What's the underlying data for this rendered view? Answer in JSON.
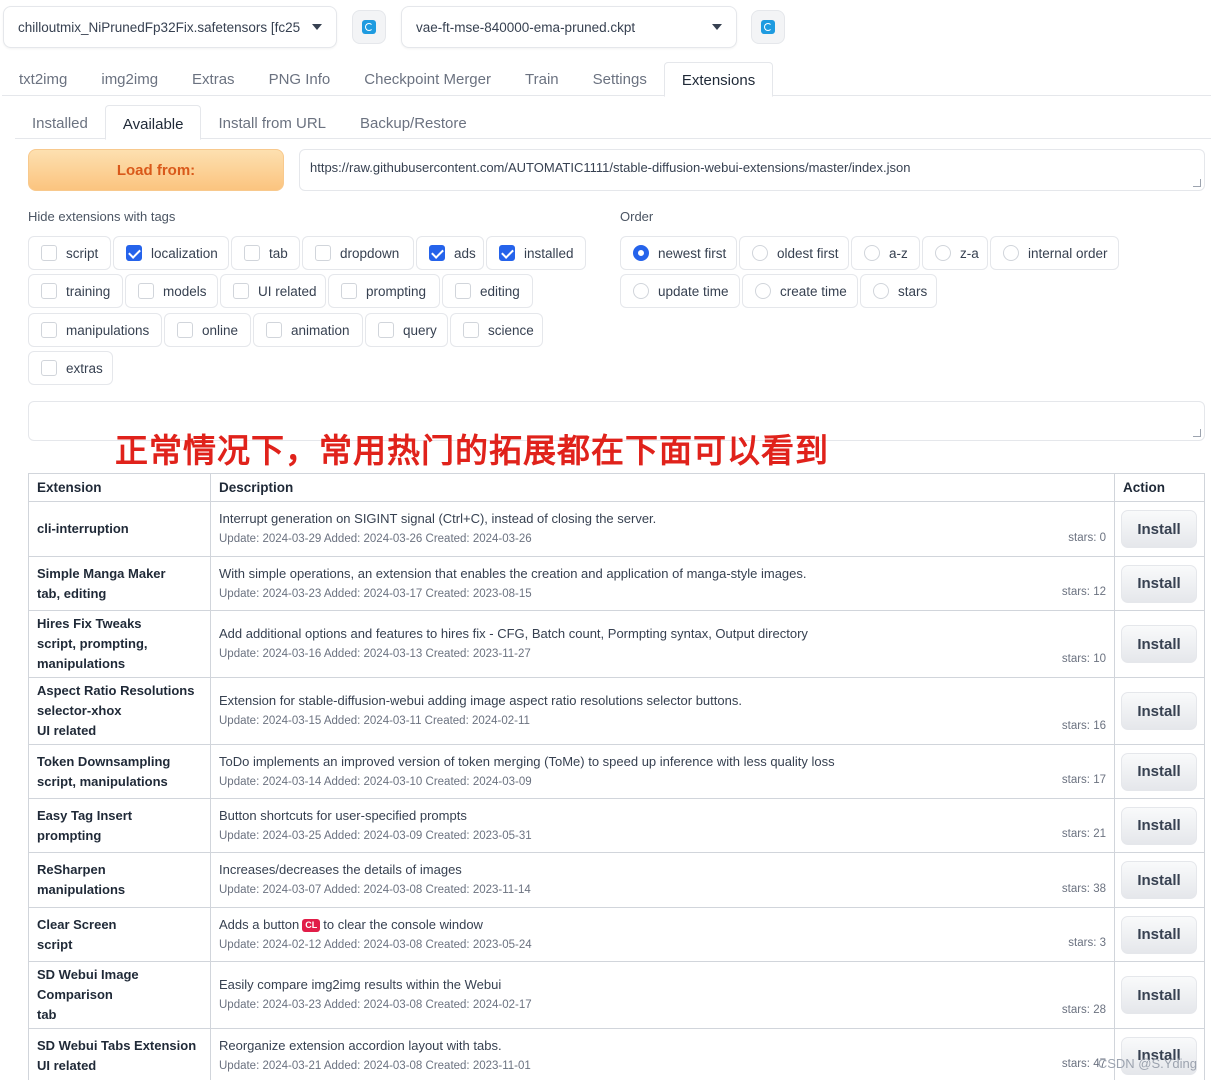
{
  "top": {
    "checkpoint": "chilloutmix_NiPrunedFp32Fix.safetensors [fc25",
    "vae": "vae-ft-mse-840000-ema-pruned.ckpt"
  },
  "tabs": [
    "txt2img",
    "img2img",
    "Extras",
    "PNG Info",
    "Checkpoint Merger",
    "Train",
    "Settings",
    "Extensions"
  ],
  "subtabs": [
    "Installed",
    "Available",
    "Install from URL",
    "Backup/Restore"
  ],
  "load": {
    "button": "Load from:",
    "url": "https://raw.githubusercontent.com/AUTOMATIC1111/stable-diffusion-webui-extensions/master/index.json"
  },
  "hide_label": "Hide extensions with tags",
  "tags": [
    {
      "label": "script",
      "checked": false
    },
    {
      "label": "localization",
      "checked": true
    },
    {
      "label": "tab",
      "checked": false
    },
    {
      "label": "dropdown",
      "checked": false
    },
    {
      "label": "ads",
      "checked": true
    },
    {
      "label": "installed",
      "checked": true
    },
    {
      "label": "training",
      "checked": false
    },
    {
      "label": "models",
      "checked": false
    },
    {
      "label": "UI related",
      "checked": false
    },
    {
      "label": "prompting",
      "checked": false
    },
    {
      "label": "editing",
      "checked": false
    },
    {
      "label": "manipulations",
      "checked": false
    },
    {
      "label": "online",
      "checked": false
    },
    {
      "label": "animation",
      "checked": false
    },
    {
      "label": "query",
      "checked": false
    },
    {
      "label": "science",
      "checked": false
    },
    {
      "label": "extras",
      "checked": false
    }
  ],
  "order_label": "Order",
  "orders": [
    {
      "label": "newest first",
      "selected": true
    },
    {
      "label": "oldest first",
      "selected": false
    },
    {
      "label": "a-z",
      "selected": false
    },
    {
      "label": "z-a",
      "selected": false
    },
    {
      "label": "internal order",
      "selected": false
    },
    {
      "label": "update time",
      "selected": false
    },
    {
      "label": "create time",
      "selected": false
    },
    {
      "label": "stars",
      "selected": false
    }
  ],
  "overlay_note": "正常情况下，常用热门的拓展都在下面可以看到",
  "table": {
    "headers": [
      "Extension",
      "Description",
      "Action"
    ],
    "install_label": "Install",
    "rows": [
      {
        "name": "cli-interruption",
        "tags": "",
        "desc": "Interrupt generation on SIGINT signal (Ctrl+C), instead of closing the server.",
        "meta": "Update: 2024-03-29 Added: 2024-03-26 Created: 2024-03-26",
        "stars": "stars: 0"
      },
      {
        "name": "Simple Manga Maker",
        "tags": "tab, editing",
        "desc": "With simple operations, an extension that enables the creation and application of manga-style images.",
        "meta": "Update: 2024-03-23 Added: 2024-03-17 Created: 2023-08-15",
        "stars": "stars: 12"
      },
      {
        "name": "Hires Fix Tweaks",
        "tags": "script, prompting, manipulations",
        "desc": "Add additional options and features to hires fix - CFG, Batch count, Pormpting syntax, Output directory",
        "meta": "Update: 2024-03-16 Added: 2024-03-13 Created: 2023-11-27",
        "stars": "stars: 10"
      },
      {
        "name": "Aspect Ratio Resolutions selector-xhox",
        "tags": "UI related",
        "desc": "Extension for stable-diffusion-webui adding image aspect ratio resolutions selector buttons.",
        "meta": "Update: 2024-03-15 Added: 2024-03-11 Created: 2024-02-11",
        "stars": "stars: 16"
      },
      {
        "name": "Token Downsampling",
        "tags": "script, manipulations",
        "desc": "ToDo implements an improved version of token merging (ToMe) to speed up inference with less quality loss",
        "meta": "Update: 2024-03-14 Added: 2024-03-10 Created: 2024-03-09",
        "stars": "stars: 17"
      },
      {
        "name": "Easy Tag Insert",
        "tags": "prompting",
        "desc": "Button shortcuts for user-specified prompts",
        "meta": "Update: 2024-03-25 Added: 2024-03-09 Created: 2023-05-31",
        "stars": "stars: 21"
      },
      {
        "name": "ReSharpen",
        "tags": "manipulations",
        "desc": "Increases/decreases the details of images",
        "meta": "Update: 2024-03-07 Added: 2024-03-08 Created: 2023-11-14",
        "stars": "stars: 38"
      },
      {
        "name": "Clear Screen",
        "tags": "script",
        "desc_pre": "Adds a button",
        "desc_badge": "CL",
        "desc_post": "to clear the console window",
        "meta": "Update: 2024-02-12 Added: 2024-03-08 Created: 2023-05-24",
        "stars": "stars: 3"
      },
      {
        "name": "SD Webui Image Comparison",
        "tags": "tab",
        "desc": "Easily compare img2img results within the Webui",
        "meta": "Update: 2024-03-23 Added: 2024-03-08 Created: 2024-02-17",
        "stars": "stars: 28"
      },
      {
        "name": "SD Webui Tabs Extension",
        "tags": "UI related",
        "desc": "Reorganize extension accordion layout with tabs.",
        "meta": "Update: 2024-03-21 Added: 2024-03-08 Created: 2023-11-01",
        "stars": "stars: 47"
      }
    ]
  },
  "watermark": "CSDN @S.Yding"
}
